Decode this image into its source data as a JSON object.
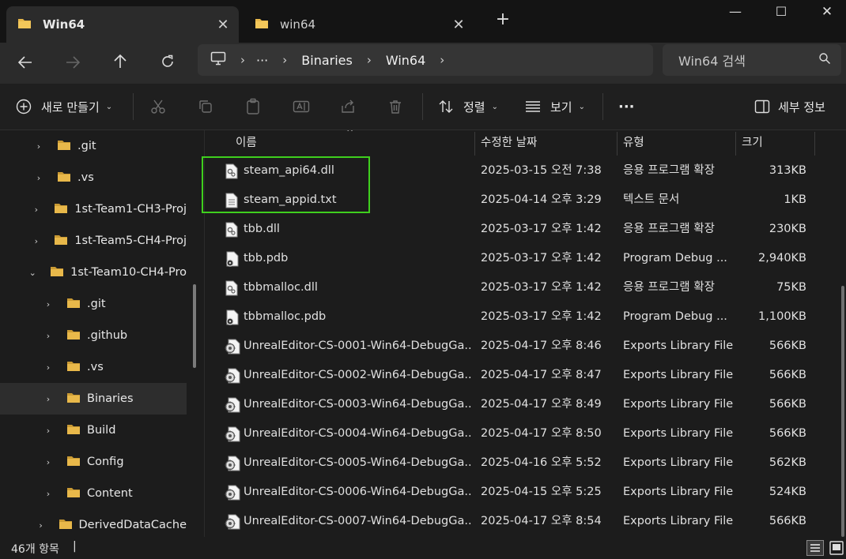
{
  "tabs": [
    {
      "label": "Win64",
      "active": true
    },
    {
      "label": "win64",
      "active": false
    }
  ],
  "window": {
    "minimize": "—",
    "maximize": "☐",
    "close": "✕",
    "new_tab": "+"
  },
  "address": {
    "ellipsis": "···",
    "crumbs": [
      "Binaries",
      "Win64"
    ],
    "search_placeholder": "Win64 검색"
  },
  "toolbar": {
    "new_label": "새로 만들기",
    "sort_label": "정렬",
    "view_label": "보기",
    "more_label": "···",
    "details_label": "세부 정보"
  },
  "nav_tree": [
    {
      "label": ".git",
      "level": 1,
      "expanded": false,
      "selected": false
    },
    {
      "label": ".vs",
      "level": 1,
      "expanded": false,
      "selected": false
    },
    {
      "label": "1st-Team1-CH3-Proj",
      "level": 1,
      "expanded": false,
      "selected": false
    },
    {
      "label": "1st-Team5-CH4-Proj",
      "level": 1,
      "expanded": false,
      "selected": false
    },
    {
      "label": "1st-Team10-CH4-Pro",
      "level": 1,
      "expanded": true,
      "selected": false
    },
    {
      "label": ".git",
      "level": 2,
      "expanded": false,
      "selected": false
    },
    {
      "label": ".github",
      "level": 2,
      "expanded": false,
      "selected": false
    },
    {
      "label": ".vs",
      "level": 2,
      "expanded": false,
      "selected": false
    },
    {
      "label": "Binaries",
      "level": 2,
      "expanded": false,
      "selected": true
    },
    {
      "label": "Build",
      "level": 2,
      "expanded": false,
      "selected": false
    },
    {
      "label": "Config",
      "level": 2,
      "expanded": false,
      "selected": false
    },
    {
      "label": "Content",
      "level": 2,
      "expanded": false,
      "selected": false
    },
    {
      "label": "DerivedDataCache",
      "level": 2,
      "expanded": false,
      "selected": false
    }
  ],
  "columns": {
    "name": "이름",
    "date": "수정한 날짜",
    "type": "유형",
    "size": "크기"
  },
  "files": [
    {
      "name": "steam_api64.dll",
      "date": "2025-03-15 오전 7:38",
      "type": "응용 프로그램 확장",
      "size": "313KB",
      "icon": "dll"
    },
    {
      "name": "steam_appid.txt",
      "date": "2025-04-14 오후 3:29",
      "type": "텍스트 문서",
      "size": "1KB",
      "icon": "txt"
    },
    {
      "name": "tbb.dll",
      "date": "2025-03-17 오후 1:42",
      "type": "응용 프로그램 확장",
      "size": "230KB",
      "icon": "dll"
    },
    {
      "name": "tbb.pdb",
      "date": "2025-03-17 오후 1:42",
      "type": "Program Debug ...",
      "size": "2,940KB",
      "icon": "pdb"
    },
    {
      "name": "tbbmalloc.dll",
      "date": "2025-03-17 오후 1:42",
      "type": "응용 프로그램 확장",
      "size": "75KB",
      "icon": "dll"
    },
    {
      "name": "tbbmalloc.pdb",
      "date": "2025-03-17 오후 1:42",
      "type": "Program Debug ...",
      "size": "1,100KB",
      "icon": "pdb"
    },
    {
      "name": "UnrealEditor-CS-0001-Win64-DebugGa...",
      "date": "2025-04-17 오후 8:46",
      "type": "Exports Library File",
      "size": "566KB",
      "icon": "exp"
    },
    {
      "name": "UnrealEditor-CS-0002-Win64-DebugGa...",
      "date": "2025-04-17 오후 8:47",
      "type": "Exports Library File",
      "size": "566KB",
      "icon": "exp"
    },
    {
      "name": "UnrealEditor-CS-0003-Win64-DebugGa...",
      "date": "2025-04-17 오후 8:49",
      "type": "Exports Library File",
      "size": "566KB",
      "icon": "exp"
    },
    {
      "name": "UnrealEditor-CS-0004-Win64-DebugGa...",
      "date": "2025-04-17 오후 8:50",
      "type": "Exports Library File",
      "size": "566KB",
      "icon": "exp"
    },
    {
      "name": "UnrealEditor-CS-0005-Win64-DebugGa...",
      "date": "2025-04-16 오후 5:52",
      "type": "Exports Library File",
      "size": "562KB",
      "icon": "exp"
    },
    {
      "name": "UnrealEditor-CS-0006-Win64-DebugGa...",
      "date": "2025-04-15 오후 5:25",
      "type": "Exports Library File",
      "size": "524KB",
      "icon": "exp"
    },
    {
      "name": "UnrealEditor-CS-0007-Win64-DebugGa...",
      "date": "2025-04-17 오후 8:54",
      "type": "Exports Library File",
      "size": "566KB",
      "icon": "exp"
    }
  ],
  "status": {
    "count": "46개 항목",
    "caret": "|"
  },
  "colors": {
    "accent_highlight": "#3fcf1e",
    "folder": "#e8b84a"
  }
}
